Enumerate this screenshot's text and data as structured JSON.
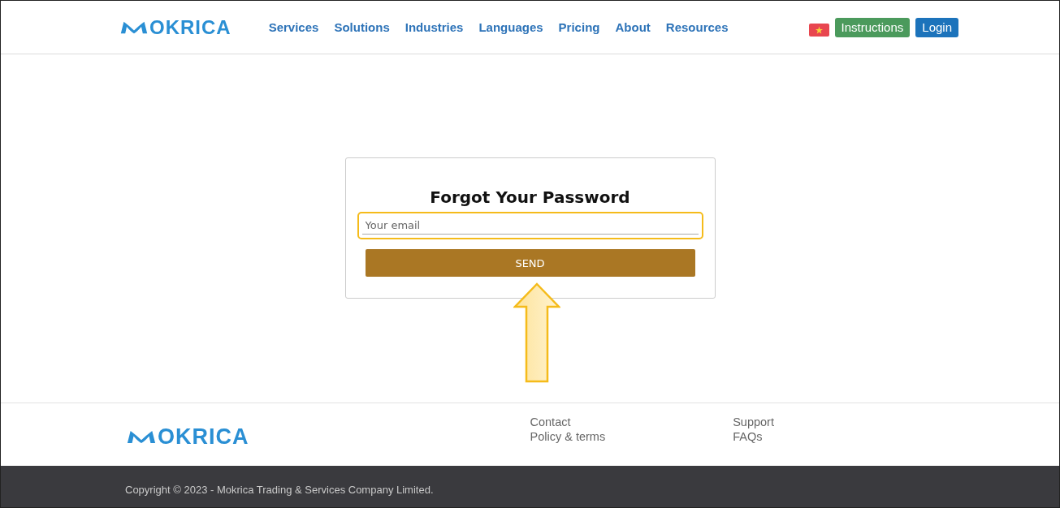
{
  "header": {
    "logo": "OKRICA",
    "nav": [
      "Services",
      "Solutions",
      "Industries",
      "Languages",
      "Pricing",
      "About",
      "Resources"
    ],
    "buttons": [
      {
        "label": "Instructions",
        "kind": "success"
      },
      {
        "label": "Login",
        "kind": "primary"
      }
    ]
  },
  "form": {
    "title": "Forgot Your Password",
    "email": {
      "placeholder": "Your email",
      "highlighted": true
    },
    "submit": "SEND"
  },
  "footer": {
    "logo": "OKRICA",
    "links_1": [
      "Contact",
      "Policy & terms"
    ],
    "links_2": [
      "Support",
      "FAQs"
    ],
    "copyright": "Copyright © 2023 - Mokrica Trading & Services Company Limited."
  }
}
